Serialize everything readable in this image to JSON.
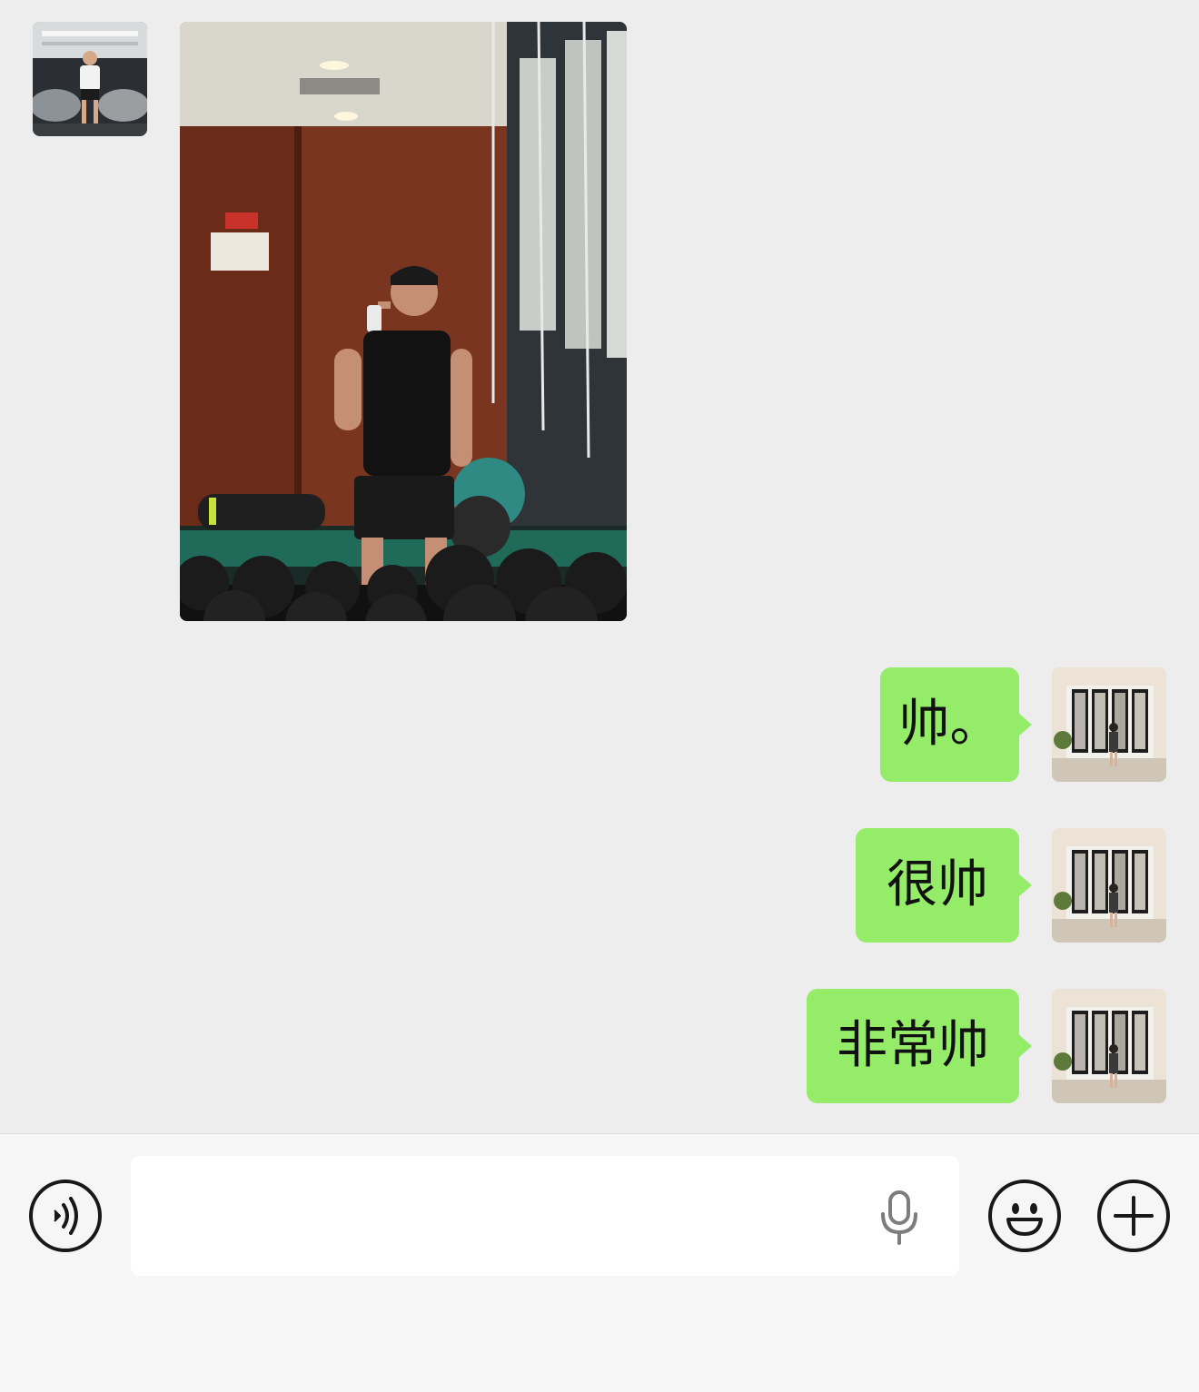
{
  "chat": {
    "incoming": {
      "avatar_icon": "contact-avatar-photo",
      "image_icon": "gym-mirror-selfie-photo"
    },
    "outgoing": [
      {
        "text": "帅。",
        "avatar_icon": "user-avatar-photo"
      },
      {
        "text": "很帅",
        "avatar_icon": "user-avatar-photo"
      },
      {
        "text": "非常帅",
        "avatar_icon": "user-avatar-photo"
      }
    ],
    "bubble_color": "#95ec69",
    "background_color": "#ededed"
  },
  "input_bar": {
    "voice_icon": "voice-mode-icon",
    "text_value": "",
    "mic_icon": "microphone-icon",
    "emoji_icon": "emoji-icon",
    "more_icon": "plus-icon"
  }
}
